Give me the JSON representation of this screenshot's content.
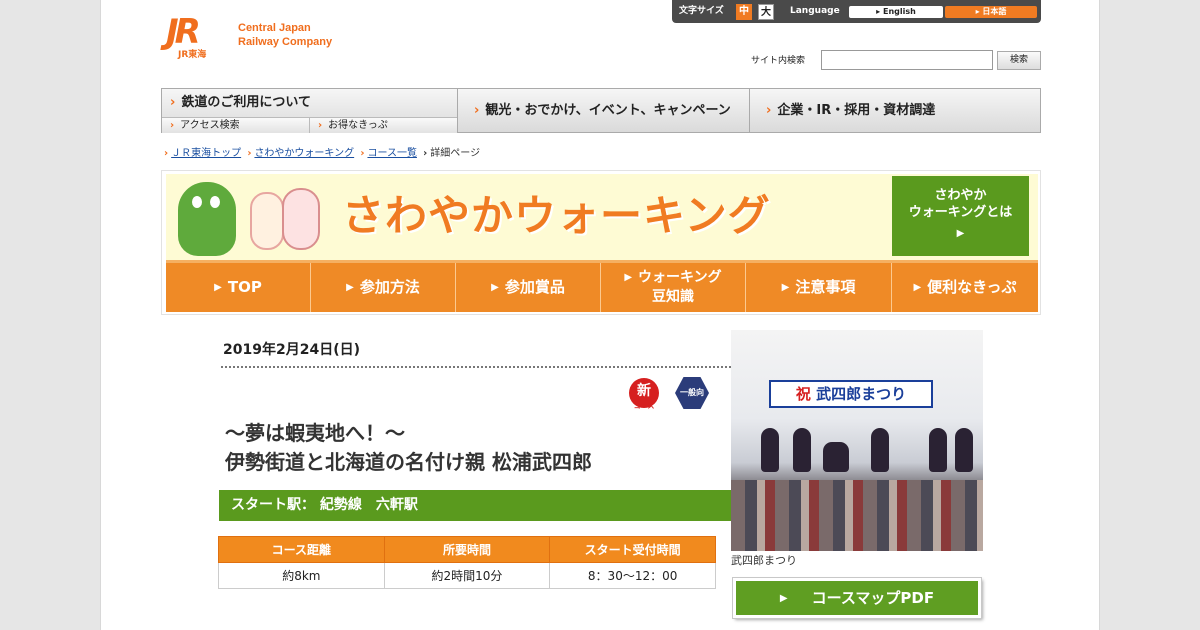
{
  "header": {
    "logo_mark": "JR",
    "logo_sub": "JR東海",
    "company_line1": "Central Japan",
    "company_line2": "Railway Company",
    "font_size_label": "文字サイズ",
    "font_size_mid": "中",
    "font_size_big": "大",
    "language_label": "Language",
    "lang_english": "▸ English",
    "lang_japanese": "▸ 日本語"
  },
  "search": {
    "label": "サイト内検索",
    "value": "",
    "button": "検索"
  },
  "global_nav": {
    "railway": "鉄道のご利用について",
    "access_search": "アクセス検索",
    "deals": "お得なきっぷ",
    "tourism": "観光・おでかけ、イベント、キャンペーン",
    "corporate": "企業・IR・採用・資材調達"
  },
  "breadcrumb": [
    "ＪＲ東海トップ",
    "さわやかウォーキング",
    "コース一覧",
    "詳細ページ"
  ],
  "banner": {
    "title": "さわやかウォーキング",
    "about_line1": "さわやか",
    "about_line2": "ウォーキングとは",
    "about_arrow": "▶"
  },
  "banner_nav": [
    {
      "label": "TOP"
    },
    {
      "label": "参加方法"
    },
    {
      "label": "参加賞品"
    },
    {
      "label": "ウォーキング",
      "label2": "豆知識"
    },
    {
      "label": "注意事項"
    },
    {
      "label": "便利なきっぷ"
    }
  ],
  "event": {
    "date": "2019年2月24日(日)",
    "badge_new": "新",
    "badge_new_sub": "コース",
    "badge_general": "一般向",
    "title_line1": "～夢は蝦夷地へ！～",
    "title_line2": "伊勢街道と北海道の名付け親 松浦武四郎",
    "start_station": "スタート駅： 紀勢線　六軒駅",
    "table_headers": [
      "コース距離",
      "所要時間",
      "スタート受付時間"
    ],
    "table_values": [
      "約8km",
      "約2時間10分",
      "8：30～12：00"
    ]
  },
  "photo": {
    "sign_prefix": "祝",
    "sign_text": "武四郎まつり",
    "caption": "武四郎まつり"
  },
  "course_map_button": "コースマップPDF",
  "colors": {
    "accent_orange": "#f07b22",
    "green": "#5a9a1e",
    "link_blue": "#1a4fa0"
  }
}
